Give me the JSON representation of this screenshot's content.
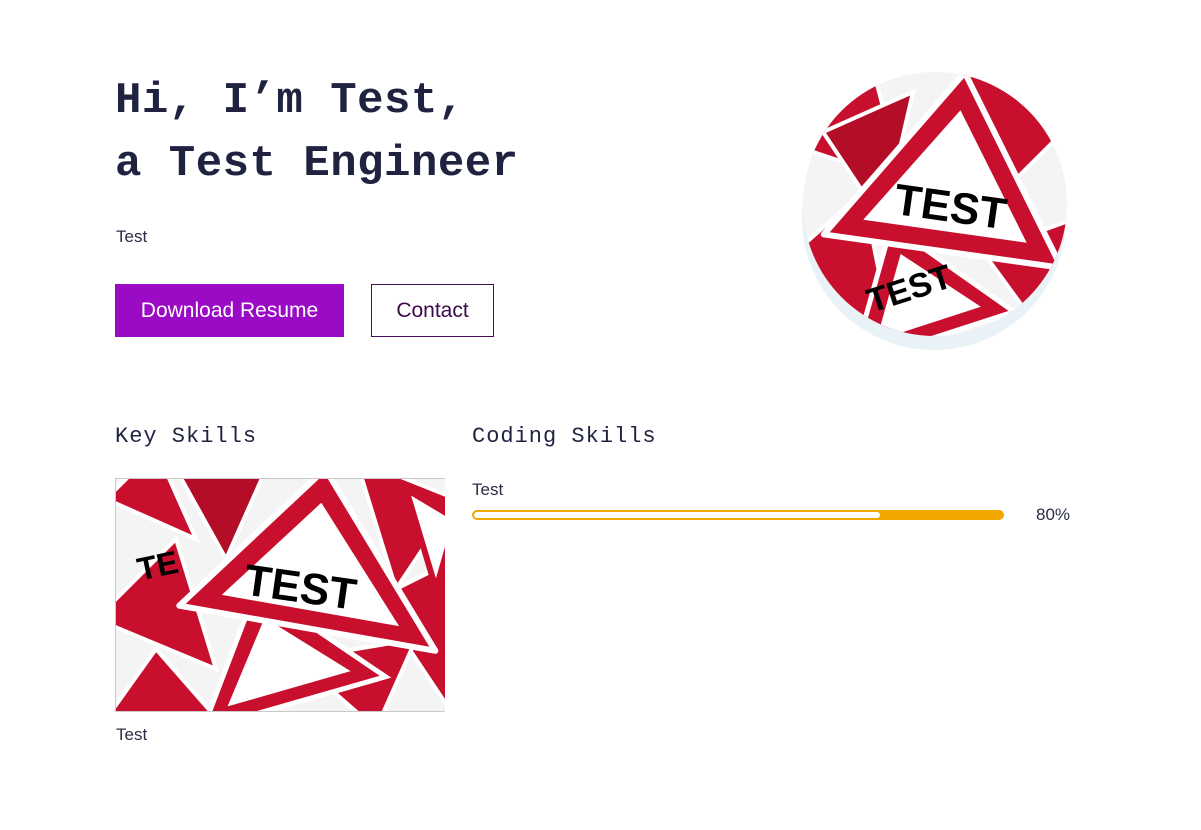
{
  "hero": {
    "title_line1": "Hi, I’m Test,",
    "title_line2": "a Test Engineer",
    "subtitle": "Test",
    "primary_button": "Download Resume",
    "secondary_button": "Contact",
    "avatar_sign_text": "TEST"
  },
  "key_skills": {
    "heading": "Key Skills",
    "cards": [
      {
        "sign_text": "TEST",
        "caption": "Test"
      }
    ]
  },
  "coding_skills": {
    "heading": "Coding Skills",
    "skills": [
      {
        "name": "Test",
        "percent_label": "80%",
        "level": 0.8
      }
    ]
  },
  "colors": {
    "primary_button": "#9b0ac4",
    "heading_text": "#1f2340",
    "progress": "#f0a800",
    "sign_red": "#c8102e"
  }
}
